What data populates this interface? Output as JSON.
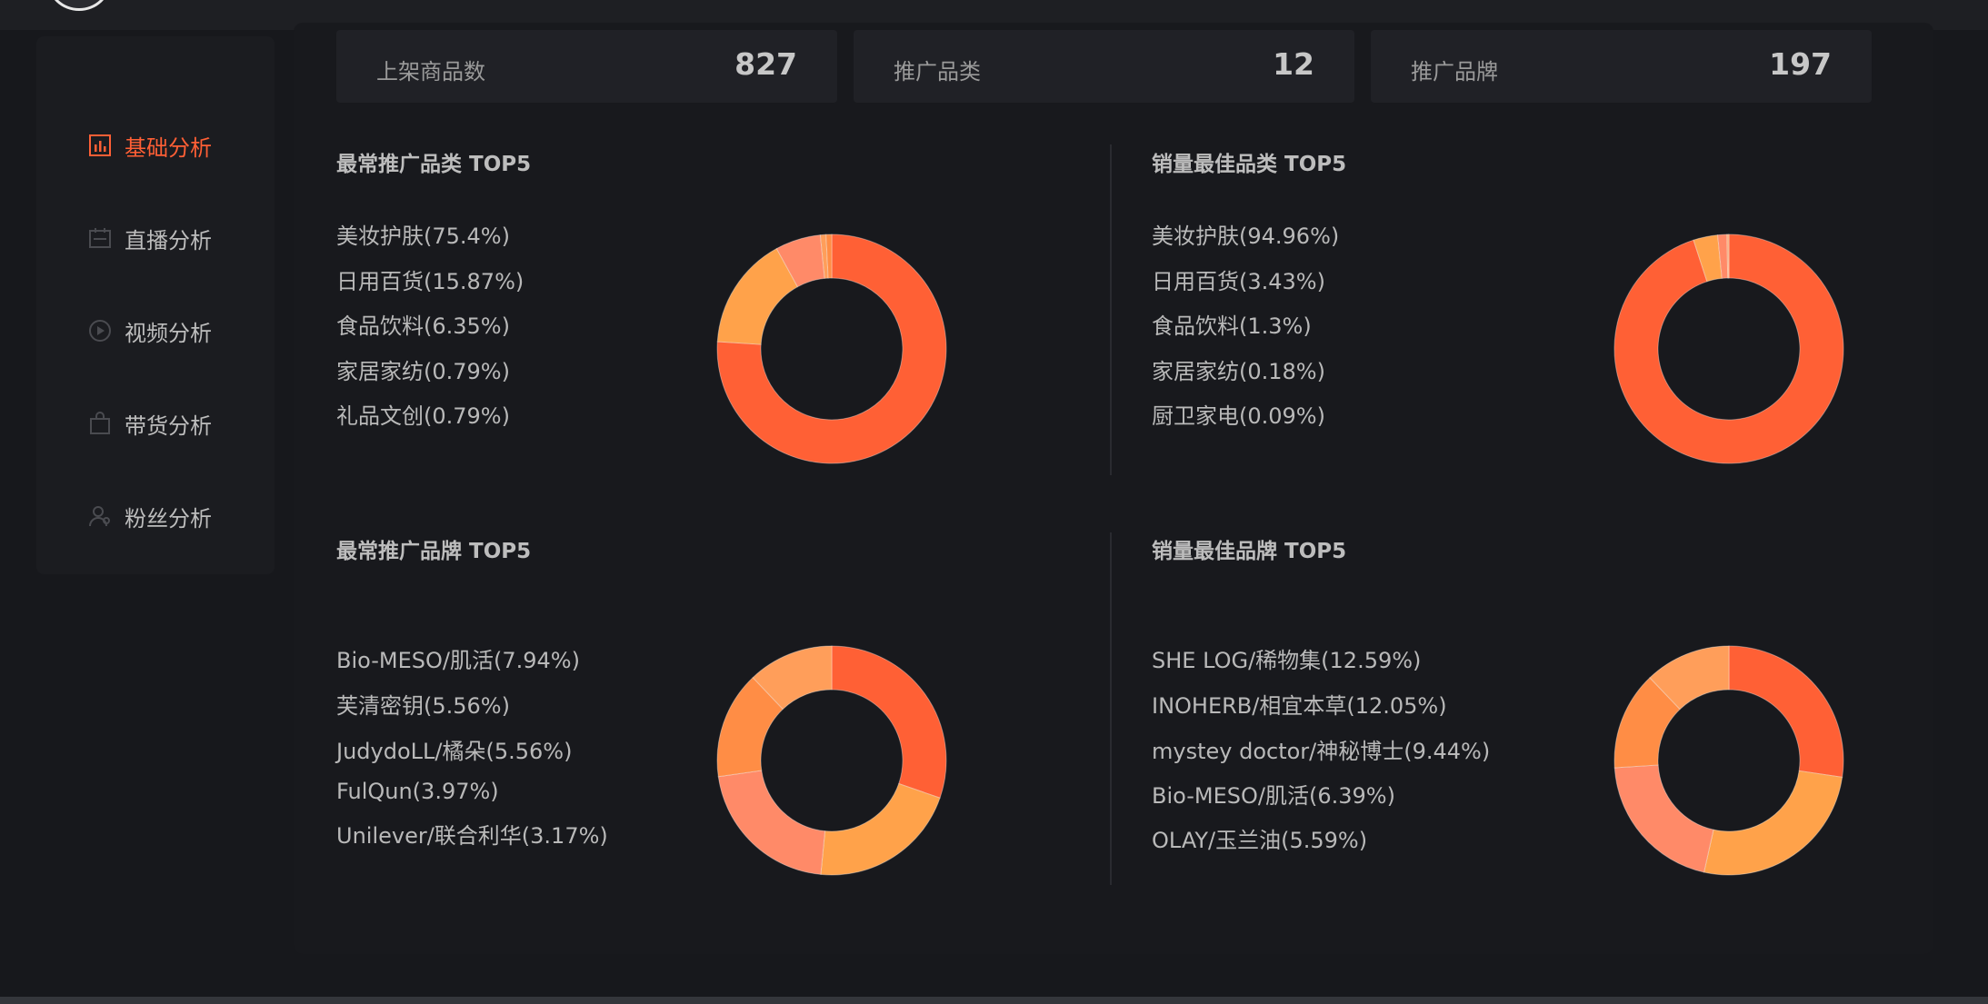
{
  "sidebar": {
    "items": [
      {
        "label": "基础分析",
        "icon": "bar-chart-icon",
        "active": true
      },
      {
        "label": "直播分析",
        "icon": "live-calendar-icon",
        "active": false
      },
      {
        "label": "视频分析",
        "icon": "play-circle-icon",
        "active": false
      },
      {
        "label": "带货分析",
        "icon": "shopping-bag-icon",
        "active": false
      },
      {
        "label": "粉丝分析",
        "icon": "user-icon",
        "active": false
      }
    ]
  },
  "stats": [
    {
      "label": "上架商品数",
      "value": "827"
    },
    {
      "label": "推广品类",
      "value": "12"
    },
    {
      "label": "推广品牌",
      "value": "197"
    }
  ],
  "colors": {
    "accent": "#ff5f35",
    "c1": "#ff6035",
    "c2": "#ffa24a",
    "c3": "#ff8a68",
    "c4": "#ff8d45",
    "c5": "#ff9e5a"
  },
  "panels": [
    {
      "title": "最常推广品类 TOP5",
      "legend": [
        "美妆护肤(75.4%)",
        "日用百货(15.87%)",
        "食品饮料(6.35%)",
        "家居家纺(0.79%)",
        "礼品文创(0.79%)"
      ]
    },
    {
      "title": "销量最佳品类 TOP5",
      "legend": [
        "美妆护肤(94.96%)",
        "日用百货(3.43%)",
        "食品饮料(1.3%)",
        "家居家纺(0.18%)",
        "厨卫家电(0.09%)"
      ]
    },
    {
      "title": "最常推广品牌 TOP5",
      "legend": [
        "Bio-MESO/肌活(7.94%)",
        "芙清密钥(5.56%)",
        "JudydoLL/橘朵(5.56%)",
        "FulQun(3.97%)",
        "Unilever/联合利华(3.17%)"
      ]
    },
    {
      "title": "销量最佳品牌 TOP5",
      "legend": [
        "SHE LOG/稀物集(12.59%)",
        "INOHERB/相宜本草(12.05%)",
        "mystey doctor/神秘博士(9.44%)",
        "Bio-MESO/肌活(6.39%)",
        "OLAY/玉兰油(5.59%)"
      ]
    }
  ],
  "chart_data": [
    {
      "type": "pie",
      "title": "最常推广品类 TOP5",
      "categories": [
        "美妆护肤",
        "日用百货",
        "食品饮料",
        "家居家纺",
        "礼品文创"
      ],
      "values": [
        75.4,
        15.87,
        6.35,
        0.79,
        0.79
      ],
      "colors": [
        "#ff6035",
        "#ffa24a",
        "#ff8a68",
        "#ff9e5a",
        "#ff8d45"
      ]
    },
    {
      "type": "pie",
      "title": "销量最佳品类 TOP5",
      "categories": [
        "美妆护肤",
        "日用百货",
        "食品饮料",
        "家居家纺",
        "厨卫家电"
      ],
      "values": [
        94.96,
        3.43,
        1.3,
        0.18,
        0.09
      ],
      "colors": [
        "#ff6035",
        "#ffa24a",
        "#ff8a68",
        "#ff9e5a",
        "#ff8d45"
      ]
    },
    {
      "type": "pie",
      "title": "最常推广品牌 TOP5",
      "categories": [
        "Bio-MESO/肌活",
        "芙清密钥",
        "JudydoLL/橘朵",
        "FulQun",
        "Unilever/联合利华"
      ],
      "values": [
        7.94,
        5.56,
        5.56,
        3.97,
        3.17
      ],
      "colors": [
        "#ff6035",
        "#ffa24a",
        "#ff8a68",
        "#ff8d45",
        "#ff9e5a"
      ]
    },
    {
      "type": "pie",
      "title": "销量最佳品牌 TOP5",
      "categories": [
        "SHE LOG/稀物集",
        "INOHERB/相宜本草",
        "mystey doctor/神秘博士",
        "Bio-MESO/肌活",
        "OLAY/玉兰油"
      ],
      "values": [
        12.59,
        12.05,
        9.44,
        6.39,
        5.59
      ],
      "colors": [
        "#ff6035",
        "#ffa24a",
        "#ff8a68",
        "#ff8d45",
        "#ff9e5a"
      ]
    }
  ]
}
